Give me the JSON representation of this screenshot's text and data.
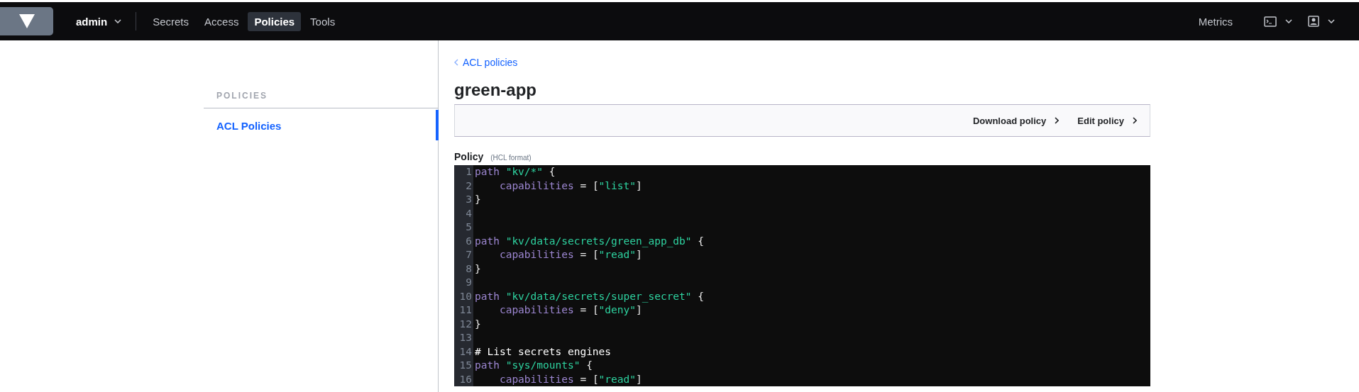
{
  "nav": {
    "namespace": "admin",
    "tabs": [
      {
        "label": "Secrets",
        "selected": false
      },
      {
        "label": "Access",
        "selected": false
      },
      {
        "label": "Policies",
        "selected": true
      },
      {
        "label": "Tools",
        "selected": false
      }
    ],
    "right_link": "Metrics"
  },
  "sidebar": {
    "heading": "POLICIES",
    "items": [
      {
        "label": "ACL Policies",
        "selected": true
      }
    ]
  },
  "breadcrumb": "ACL policies",
  "title": "green-app",
  "toolbar": {
    "actions": [
      "Download policy",
      "Edit policy"
    ]
  },
  "policy": {
    "label": "Policy",
    "hint": "(HCL format)",
    "lines": [
      {
        "number": "1",
        "tokens": [
          {
            "kind": "keyword",
            "text": "path "
          },
          {
            "kind": "string",
            "text": "\"kv/*\""
          },
          {
            "kind": "punct",
            "text": " {"
          }
        ]
      },
      {
        "number": "2",
        "tokens": [
          {
            "kind": "attr",
            "text": "    capabilities"
          },
          {
            "kind": "punct",
            "text": " = ["
          },
          {
            "kind": "string",
            "text": "\"list\""
          },
          {
            "kind": "punct",
            "text": "]"
          }
        ]
      },
      {
        "number": "3",
        "tokens": [
          {
            "kind": "punct",
            "text": "}"
          }
        ]
      },
      {
        "number": "4"
      },
      {
        "number": "5"
      },
      {
        "number": "6",
        "tokens": [
          {
            "kind": "keyword",
            "text": "path "
          },
          {
            "kind": "string",
            "text": "\"kv/data/secrets/green_app_db\""
          },
          {
            "kind": "punct",
            "text": " {"
          }
        ]
      },
      {
        "number": "7",
        "tokens": [
          {
            "kind": "attr",
            "text": "    capabilities"
          },
          {
            "kind": "punct",
            "text": " = ["
          },
          {
            "kind": "string",
            "text": "\"read\""
          },
          {
            "kind": "punct",
            "text": "]"
          }
        ]
      },
      {
        "number": "8",
        "tokens": [
          {
            "kind": "punct",
            "text": "}"
          }
        ]
      },
      {
        "number": "9"
      },
      {
        "number": "10",
        "tokens": [
          {
            "kind": "keyword",
            "text": "path "
          },
          {
            "kind": "string",
            "text": "\"kv/data/secrets/super_secret\""
          },
          {
            "kind": "punct",
            "text": " {"
          }
        ]
      },
      {
        "number": "11",
        "tokens": [
          {
            "kind": "attr",
            "text": "    capabilities"
          },
          {
            "kind": "punct",
            "text": " = ["
          },
          {
            "kind": "string",
            "text": "\"deny\""
          },
          {
            "kind": "punct",
            "text": "]"
          }
        ]
      },
      {
        "number": "12",
        "tokens": [
          {
            "kind": "punct",
            "text": "}"
          }
        ]
      },
      {
        "number": "13"
      },
      {
        "number": "14",
        "tokens": [
          {
            "kind": "comment",
            "text": "# List secrets engines"
          }
        ]
      },
      {
        "number": "15",
        "tokens": [
          {
            "kind": "keyword",
            "text": "path "
          },
          {
            "kind": "string",
            "text": "\"sys/mounts\""
          },
          {
            "kind": "punct",
            "text": " {"
          }
        ]
      },
      {
        "number": "16",
        "tokens": [
          {
            "kind": "attr",
            "text": "    capabilities"
          },
          {
            "kind": "punct",
            "text": " = ["
          },
          {
            "kind": "string",
            "text": "\"read\""
          },
          {
            "kind": "punct",
            "text": "]"
          }
        ]
      }
    ]
  }
}
